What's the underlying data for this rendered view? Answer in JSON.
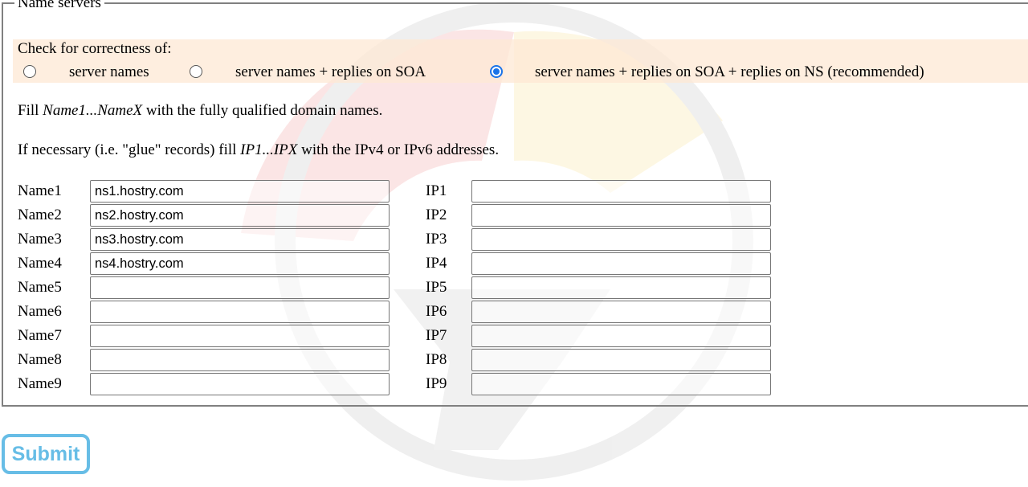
{
  "fieldset": {
    "legend": "Name servers"
  },
  "check": {
    "label": "Check for correctness of:",
    "options": [
      {
        "label": "server names",
        "selected": false
      },
      {
        "label": "server names + replies on SOA",
        "selected": false
      },
      {
        "label": "server names + replies on SOA + replies on NS (recommended)",
        "selected": true
      }
    ]
  },
  "instructions": {
    "line1_prefix": "Fill ",
    "line1_em": "Name1...NameX",
    "line1_suffix": " with the fully qualified domain names.",
    "line2_prefix": "If necessary (i.e. \"glue\" records) fill ",
    "line2_em": "IP1...IPX",
    "line2_suffix": " with the IPv4 or IPv6 addresses."
  },
  "rows": [
    {
      "name_label": "Name1",
      "name_value": "ns1.hostry.com",
      "ip_label": "IP1",
      "ip_value": ""
    },
    {
      "name_label": "Name2",
      "name_value": "ns2.hostry.com",
      "ip_label": "IP2",
      "ip_value": ""
    },
    {
      "name_label": "Name3",
      "name_value": "ns3.hostry.com",
      "ip_label": "IP3",
      "ip_value": ""
    },
    {
      "name_label": "Name4",
      "name_value": "ns4.hostry.com",
      "ip_label": "IP4",
      "ip_value": ""
    },
    {
      "name_label": "Name5",
      "name_value": "",
      "ip_label": "IP5",
      "ip_value": ""
    },
    {
      "name_label": "Name6",
      "name_value": "",
      "ip_label": "IP6",
      "ip_value": ""
    },
    {
      "name_label": "Name7",
      "name_value": "",
      "ip_label": "IP7",
      "ip_value": ""
    },
    {
      "name_label": "Name8",
      "name_value": "",
      "ip_label": "IP8",
      "ip_value": ""
    },
    {
      "name_label": "Name9",
      "name_value": "",
      "ip_label": "IP9",
      "ip_value": ""
    }
  ],
  "submit": {
    "label": "Submit"
  },
  "colors": {
    "accent": "#67bde6",
    "band": "#fde8d4",
    "radio_checked": "#1a73e8"
  }
}
